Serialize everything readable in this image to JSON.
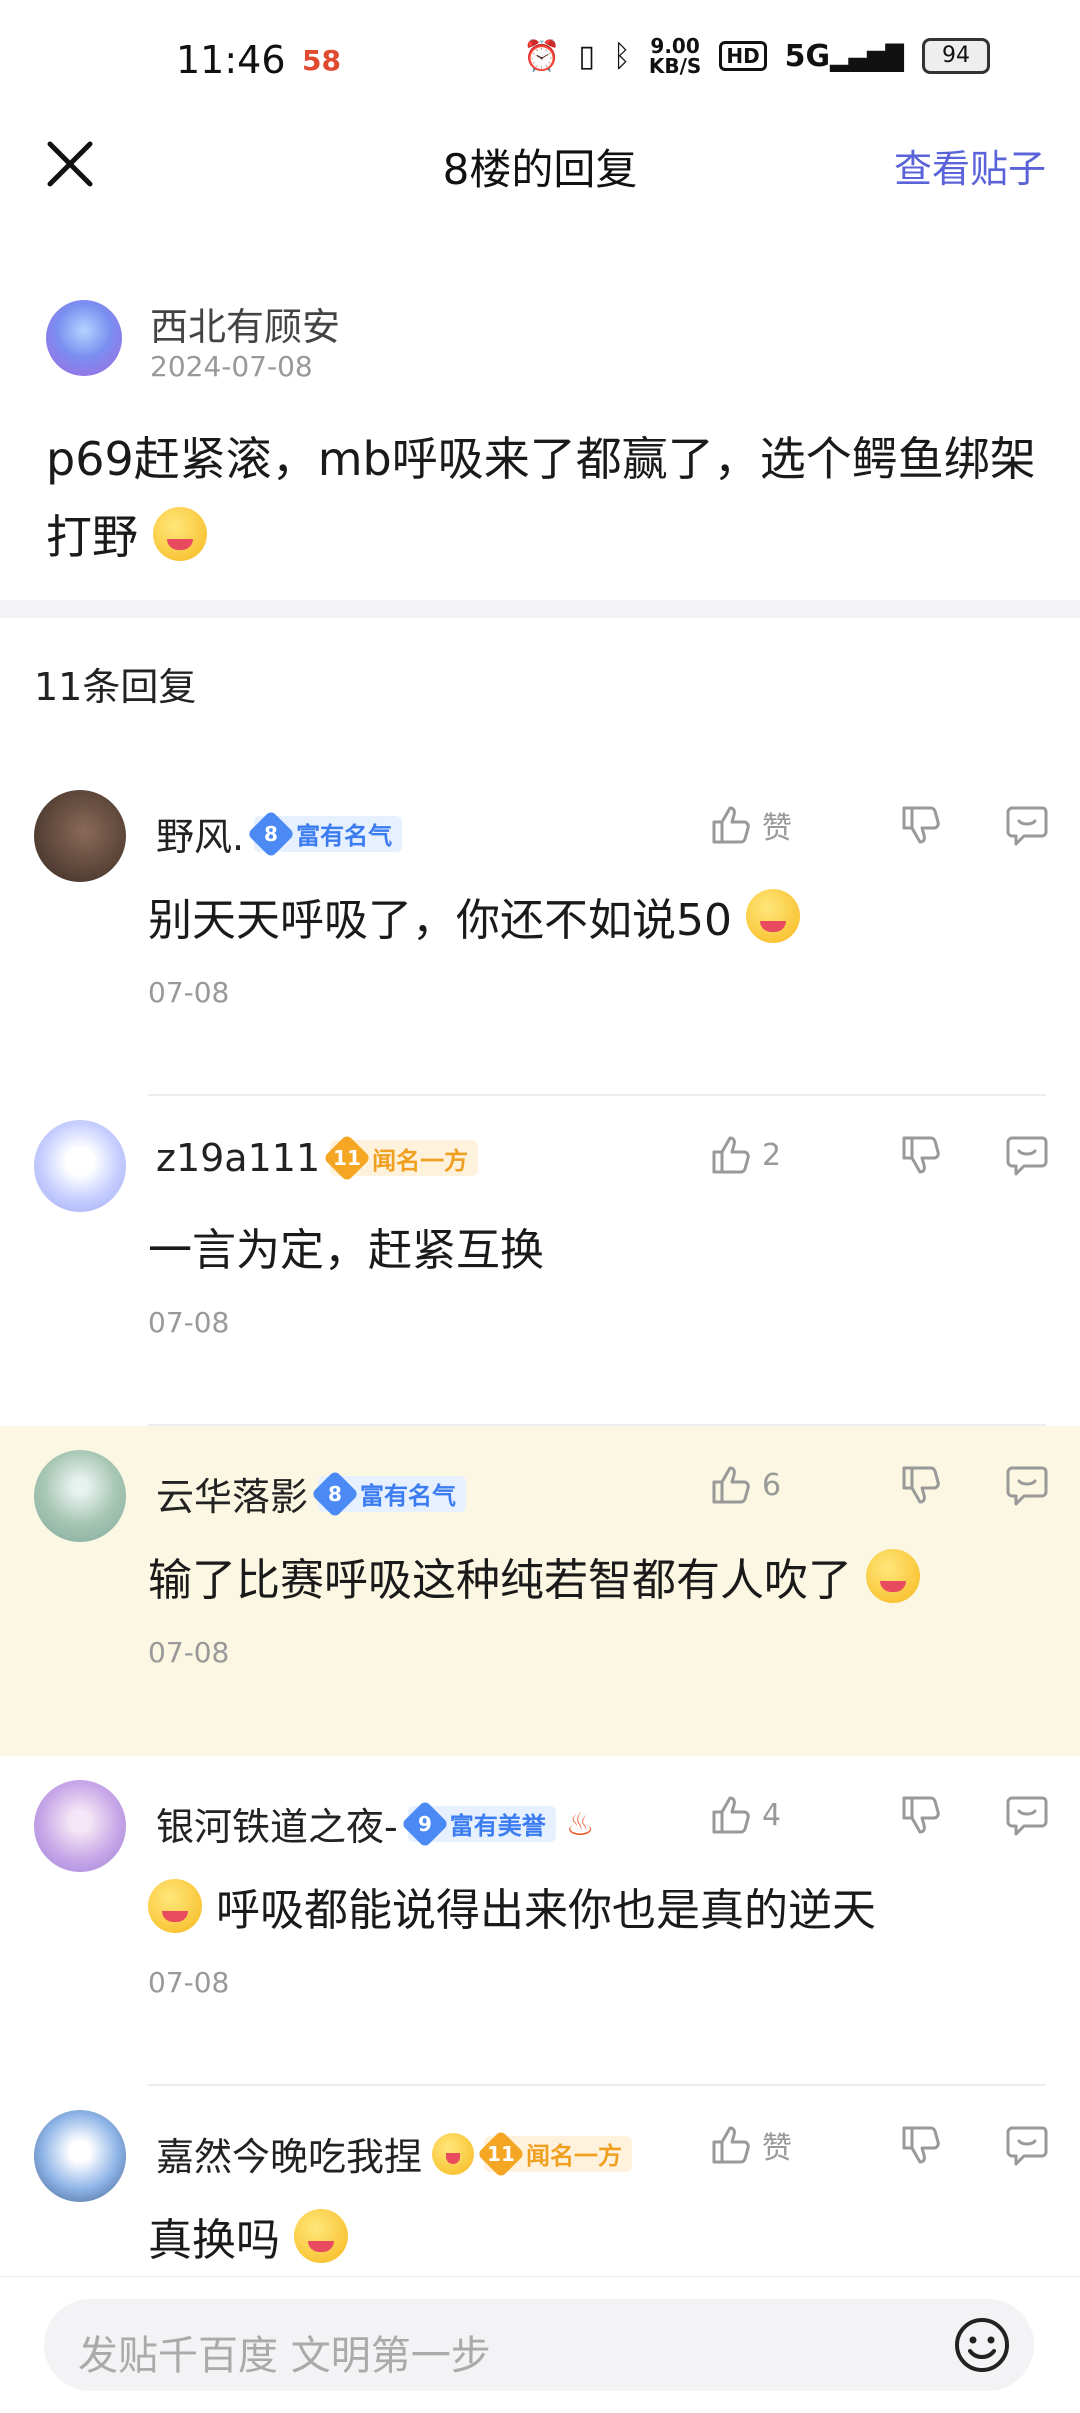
{
  "status_bar": {
    "time": "11:46",
    "app_icon_label": "58",
    "network_speed": "9.00\nKB/S",
    "hd_label": "HD",
    "signal_label": "5G",
    "battery": "94"
  },
  "header": {
    "title": "8楼的回复",
    "view_post_label": "查看贴子"
  },
  "main_post": {
    "author": "西北有顾安",
    "date": "2024-07-08",
    "content": "p69赶紧滚，mb呼吸来了都赢了，选个鳄鱼绑架打野"
  },
  "reply_count_label": "11条回复",
  "replies": [
    {
      "name": "野风.",
      "badge_level": "8",
      "badge_text": "富有名气",
      "badge_color": "blue",
      "like_label": "赞",
      "text": "别天天呼吸了，你还不如说50",
      "date": "07-08"
    },
    {
      "name": "z19a111",
      "badge_level": "11",
      "badge_text": "闻名一方",
      "badge_color": "gold",
      "like_label": "2",
      "text": "一言为定，赶紧互换",
      "date": "07-08"
    },
    {
      "name": "云华落影",
      "badge_level": "8",
      "badge_text": "富有名气",
      "badge_color": "blue",
      "like_label": "6",
      "text": "输了比赛呼吸这种纯若智都有人吹了",
      "date": "07-08"
    },
    {
      "name": "银河铁道之夜-",
      "badge_level": "9",
      "badge_text": "富有美誉",
      "badge_color": "blue",
      "like_label": "4",
      "text": "呼吸都能说得出来你也是真的逆天",
      "date": "07-08"
    },
    {
      "name": "嘉然今晚吃我捏",
      "badge_level": "11",
      "badge_text": "闻名一方",
      "badge_color": "gold",
      "like_label": "赞",
      "text": "真换吗",
      "date": ""
    }
  ],
  "input": {
    "placeholder": "发贴千百度 文明第一步"
  },
  "colors": {
    "accent": "#5b63d8",
    "highlight_bg": "#fbf7e3",
    "badge_blue": "#4b8af5",
    "badge_gold": "#f5a623"
  }
}
